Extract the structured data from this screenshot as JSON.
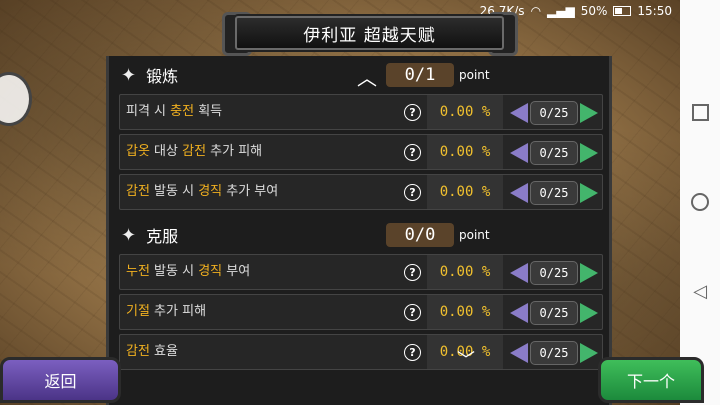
{
  "status": {
    "speed": "26.7K/s",
    "battery": "50%",
    "time": "15:50"
  },
  "title": "伊利亚  超越天赋",
  "sections": [
    {
      "name": "锻炼",
      "points": "0/1",
      "points_unit": "point",
      "rows": [
        {
          "parts": [
            [
              "피격 시 ",
              false
            ],
            [
              "충전",
              true
            ],
            [
              " 획득",
              false
            ]
          ],
          "percent": "0.00 %",
          "level": "0/25"
        },
        {
          "parts": [
            [
              "갑옷",
              true
            ],
            [
              " 대상 ",
              false
            ],
            [
              "감전",
              true
            ],
            [
              " 추가 피해",
              false
            ]
          ],
          "percent": "0.00 %",
          "level": "0/25"
        },
        {
          "parts": [
            [
              "감전",
              true
            ],
            [
              " 발동 시 ",
              false
            ],
            [
              "경직",
              true
            ],
            [
              " 추가 부여",
              false
            ]
          ],
          "percent": "0.00 %",
          "level": "0/25"
        }
      ]
    },
    {
      "name": "克服",
      "points": "0/0",
      "points_unit": "point",
      "rows": [
        {
          "parts": [
            [
              "누전",
              true
            ],
            [
              " 발동 시 ",
              false
            ],
            [
              "경직",
              true
            ],
            [
              " 부여",
              false
            ]
          ],
          "percent": "0.00 %",
          "level": "0/25"
        },
        {
          "parts": [
            [
              "기절",
              true
            ],
            [
              " 추가 피해",
              false
            ]
          ],
          "percent": "0.00 %",
          "level": "0/25"
        },
        {
          "parts": [
            [
              "감전",
              true
            ],
            [
              " 효율",
              false
            ]
          ],
          "percent": "0.00 %",
          "level": "0/25"
        }
      ]
    }
  ],
  "buttons": {
    "back": "返回",
    "next": "下一个"
  },
  "icons": {
    "help": "?",
    "section_star": "✦",
    "collapse": "︿",
    "scroll_down": "﹀"
  },
  "colors": {
    "highlight": "#f0b020",
    "percent": "#f2c12e",
    "decrease": "#8a7cc8",
    "increase": "#43b56c"
  }
}
